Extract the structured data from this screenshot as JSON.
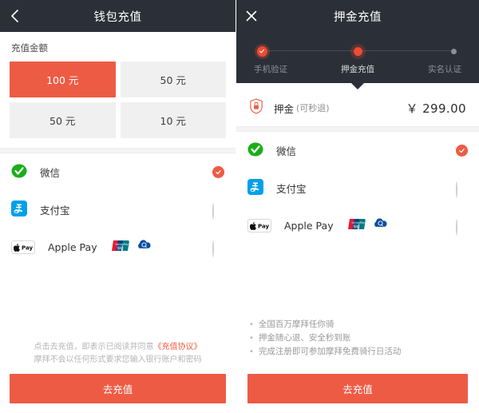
{
  "left": {
    "navbar": {
      "title": "钱包充值",
      "back_icon": "chevron-left-icon"
    },
    "amount_section": {
      "label": "充值金额",
      "options": [
        {
          "label": "100 元",
          "selected": true
        },
        {
          "label": "50 元",
          "selected": false
        },
        {
          "label": "50 元",
          "selected": false
        },
        {
          "label": "10 元",
          "selected": false
        }
      ]
    },
    "payment_methods": [
      {
        "name": "微信",
        "icon": "wechat-icon",
        "selected": true,
        "logos": []
      },
      {
        "name": "支付宝",
        "icon": "alipay-icon",
        "selected": false,
        "logos": []
      },
      {
        "name": "Apple Pay",
        "icon": "apple-pay-icon",
        "selected": false,
        "logos": [
          "unionpay-logo",
          "quickpass-logo"
        ]
      }
    ],
    "footer": {
      "agreement_prefix": "点击去充值，即表示已阅读并同意",
      "agreement_link": "《充值协议》",
      "agreement_note": "摩拜不会以任何形式要求您输入银行账户和密码",
      "cta_label": "去充值"
    }
  },
  "right": {
    "navbar": {
      "title": "押金充值",
      "close_icon": "close-icon"
    },
    "stepper": {
      "steps": [
        {
          "label": "手机验证",
          "state": "done"
        },
        {
          "label": "押金充值",
          "state": "current"
        },
        {
          "label": "实名认证",
          "state": "todo"
        }
      ]
    },
    "deposit": {
      "icon": "shield-lock-icon",
      "name": "押金",
      "note": "(可秒退)",
      "amount": "￥ 299.00"
    },
    "payment_methods": [
      {
        "name": "微信",
        "icon": "wechat-icon",
        "selected": true,
        "logos": []
      },
      {
        "name": "支付宝",
        "icon": "alipay-icon",
        "selected": false,
        "logos": []
      },
      {
        "name": "Apple Pay",
        "icon": "apple-pay-icon",
        "selected": false,
        "logos": [
          "unionpay-logo",
          "quickpass-logo"
        ]
      }
    ],
    "benefits": [
      "全国百万摩拜任你骑",
      "押金随心退、安全秒到账",
      "完成注册即可参加摩拜免费骑行日活动"
    ],
    "footer": {
      "cta_label": "去充值"
    }
  },
  "colors": {
    "accent": "#ee5b45",
    "navbar_bg": "#2b3038",
    "tile_bg": "#f0f0f0",
    "muted_text": "#9a9a9a"
  }
}
